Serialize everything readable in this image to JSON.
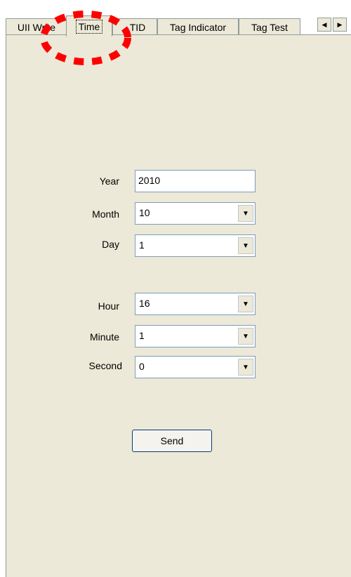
{
  "tabs": [
    {
      "label": "UII Write"
    },
    {
      "label": "Time",
      "active": true
    },
    {
      "label": "TID"
    },
    {
      "label": "Tag Indicator"
    },
    {
      "label": "Tag Test"
    }
  ],
  "scroll": {
    "left_icon": "arrow-left-icon",
    "right_icon": "arrow-right-icon"
  },
  "form": {
    "year": {
      "label": "Year",
      "value": "2010"
    },
    "month": {
      "label": "Month",
      "value": "10"
    },
    "day": {
      "label": "Day",
      "value": "1"
    },
    "hour": {
      "label": "Hour",
      "value": "16"
    },
    "minute": {
      "label": "Minute",
      "value": "1"
    },
    "second": {
      "label": "Second",
      "value": "0"
    }
  },
  "send_label": "Send",
  "annotation": {
    "color": "#ff0000",
    "shape": "dashed-circle-highlight"
  }
}
